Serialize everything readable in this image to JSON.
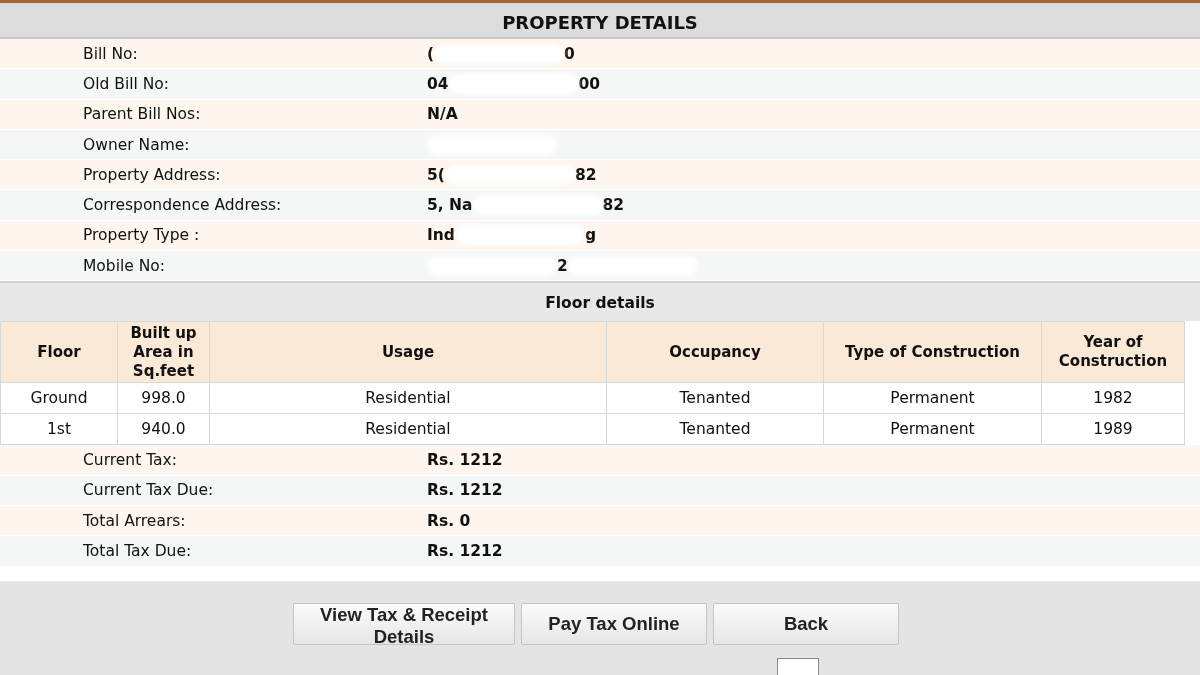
{
  "title": "PROPERTY DETAILS",
  "details": [
    {
      "label": "Bill No:",
      "value": [
        {
          "kind": "text",
          "text": "("
        },
        {
          "kind": "redacted"
        },
        {
          "kind": "text",
          "text": "0"
        }
      ]
    },
    {
      "label": "Old Bill No:",
      "value": [
        {
          "kind": "text",
          "text": "04"
        },
        {
          "kind": "redacted"
        },
        {
          "kind": "text",
          "text": "00"
        }
      ]
    },
    {
      "label": "Parent Bill Nos:",
      "value": [
        {
          "kind": "text",
          "text": "N/A"
        }
      ]
    },
    {
      "label": "Owner Name:",
      "value": [
        {
          "kind": "redacted"
        }
      ]
    },
    {
      "label": "Property Address:",
      "value": [
        {
          "kind": "text",
          "text": "5("
        },
        {
          "kind": "redacted"
        },
        {
          "kind": "text",
          "text": "82"
        }
      ]
    },
    {
      "label": "Correspondence Address:",
      "value": [
        {
          "kind": "text",
          "text": "5, Na"
        },
        {
          "kind": "redacted"
        },
        {
          "kind": "text",
          "text": "82"
        }
      ]
    },
    {
      "label": "Property Type :",
      "value": [
        {
          "kind": "text",
          "text": "Ind"
        },
        {
          "kind": "redacted"
        },
        {
          "kind": "text",
          "text": "g"
        }
      ]
    },
    {
      "label": "Mobile No:",
      "value": [
        {
          "kind": "redacted"
        },
        {
          "kind": "text",
          "text": "2"
        },
        {
          "kind": "redacted"
        }
      ]
    }
  ],
  "floor_details": {
    "title": "Floor details",
    "columns": [
      "Floor",
      "Built up Area in Sq.feet",
      "Usage",
      "Occupancy",
      "Type of Construction",
      "Year of Construction"
    ],
    "rows": [
      [
        "Ground",
        "998.0",
        "Residential",
        "Tenanted",
        "Permanent",
        "1982"
      ],
      [
        "1st",
        "940.0",
        "Residential",
        "Tenanted",
        "Permanent",
        "1989"
      ]
    ]
  },
  "tax": [
    {
      "label": "Current Tax:",
      "value": "Rs. 1212"
    },
    {
      "label": "Current Tax Due:",
      "value": "Rs. 1212"
    },
    {
      "label": "Total Arrears:",
      "value": "Rs. 0"
    },
    {
      "label": "Total Tax Due:",
      "value": "Rs. 1212"
    }
  ],
  "buttons": [
    "View Tax & Receipt Details",
    "Pay Tax Online",
    "Back"
  ]
}
